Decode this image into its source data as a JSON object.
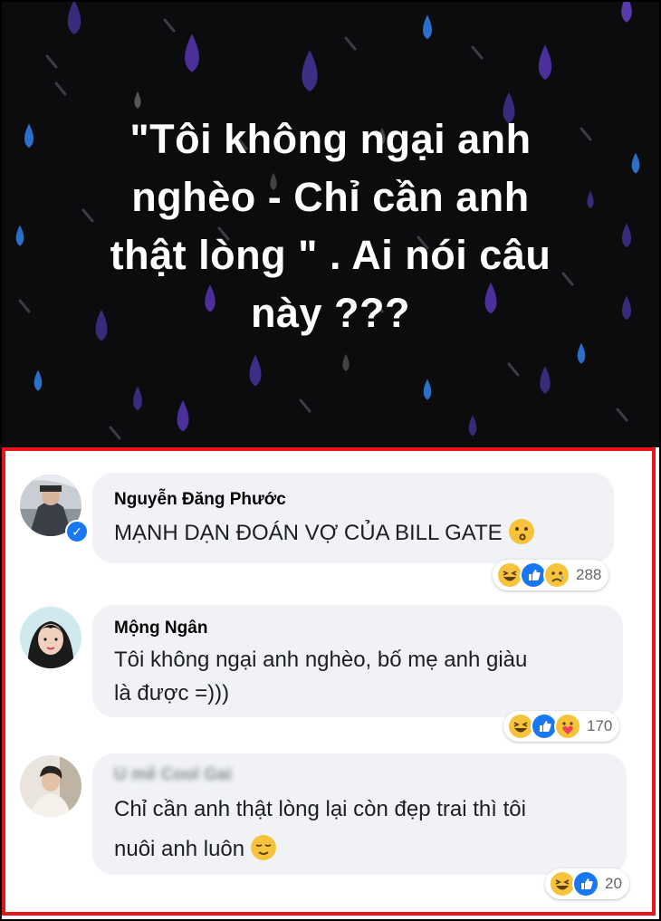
{
  "post": {
    "text_line1": "\"Tôi không ngại anh",
    "text_line2": "nghèo - Chỉ cần anh",
    "text_line3": "thật lòng \" . Ai nói câu",
    "text_line4": "này ???"
  },
  "comments": [
    {
      "author": "Nguyễn Đăng Phước",
      "verified": true,
      "text": "MẠNH DẠN ĐOÁN VỢ CỦA BILL GATE",
      "trailing_emoji": "kissing-face",
      "reactions": [
        "haha",
        "like",
        "sad"
      ],
      "reaction_count": "288"
    },
    {
      "author": "Mộng Ngân",
      "text_line1": "Tôi không ngại anh nghèo, bố mẹ anh giàu",
      "text_line2": "là được =)))",
      "reactions": [
        "haha",
        "like",
        "care"
      ],
      "reaction_count": "170"
    },
    {
      "author": "U mê Cool Gai",
      "author_blurred": true,
      "text_line1": "Chỉ cần anh thật lòng lại còn đẹp trai thì tôi",
      "text_line2": "nuôi anh luôn",
      "trailing_emoji": "relieved-face",
      "reactions": [
        "haha",
        "like"
      ],
      "reaction_count": "20"
    }
  ],
  "colors": {
    "highlight_border": "#e8141c",
    "banner_bg": "#0c0c0f",
    "bubble_bg": "#f0f2f5",
    "like_blue": "#1877f2",
    "emoji_yellow": "#f7c33b"
  }
}
